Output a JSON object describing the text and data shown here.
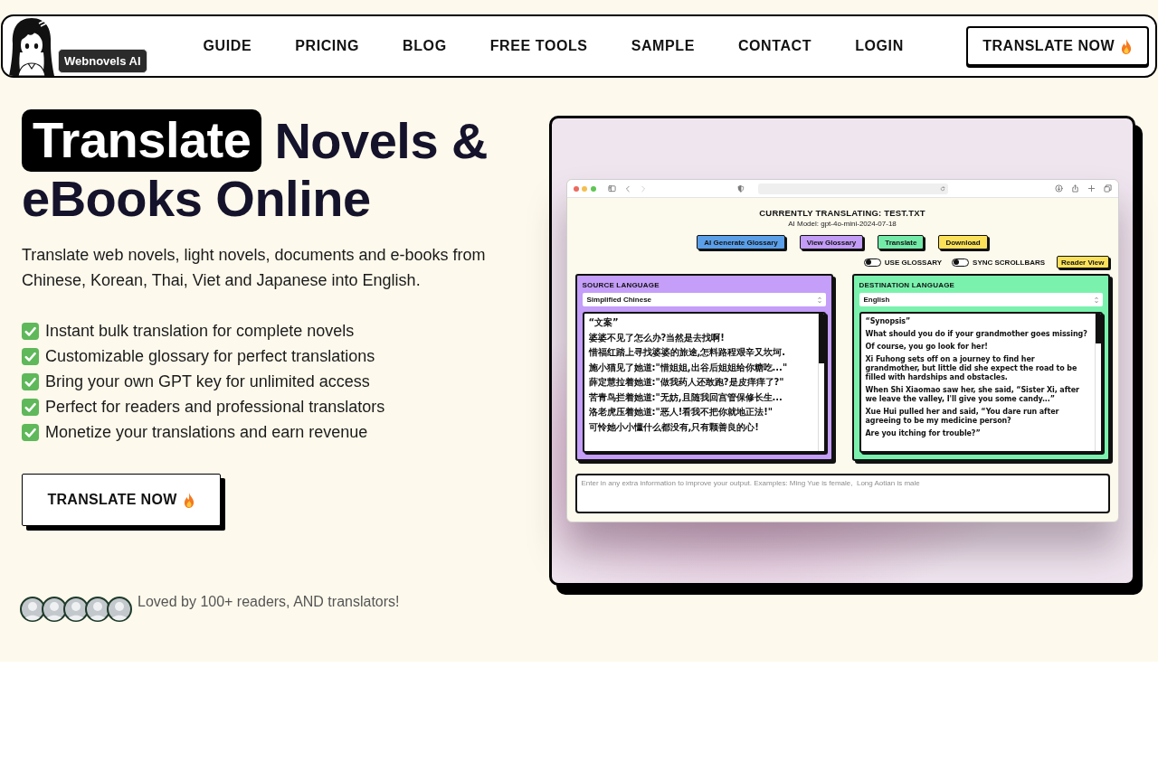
{
  "header": {
    "logo_badge": "Webnovels AI",
    "nav": [
      "GUIDE",
      "PRICING",
      "BLOG",
      "FREE TOOLS",
      "SAMPLE",
      "CONTACT",
      "LOGIN"
    ],
    "cta": "TRANSLATE NOW"
  },
  "hero": {
    "title": [
      {
        "text": "Translate",
        "highlighted": true
      },
      {
        "text": "Novels &",
        "highlighted": false
      },
      {
        "text": "eBooks Online",
        "highlighted": false
      }
    ],
    "description": "Translate web novels, light novels, documents and e-books from Chinese, Korean, Thai, Viet and Japanese into English.",
    "features": [
      "Instant bulk translation for complete novels",
      "Customizable glossary for perfect translations",
      "Bring your own GPT key for unlimited access",
      "Perfect for readers and professional translators",
      "Monetize your translations and earn revenue"
    ],
    "cta": "TRANSLATE NOW",
    "social_proof": "Loved by 100+ readers, AND translators!"
  },
  "preview": {
    "title": "CURRENTLY TRANSLATING: TEST.TXT",
    "model": "AI Model: gpt-4o-mini-2024-07-18",
    "actions": [
      {
        "label": "AI Generate Glossary",
        "color": "#5b9fe8"
      },
      {
        "label": "View Glossary",
        "color": "#c29cf6"
      },
      {
        "label": "Translate",
        "color": "#74eaa8"
      },
      {
        "label": "Download",
        "color": "#fbe15a"
      }
    ],
    "toggles": [
      {
        "label": "USE GLOSSARY",
        "on": false
      },
      {
        "label": "SYNC SCROLLBARS",
        "on": false
      }
    ],
    "reader_view": "Reader View",
    "panels": [
      {
        "kind": "source",
        "heading": "SOURCE LANGUAGE",
        "language": "Simplified Chinese",
        "color": "#c49ef8",
        "paragraphs": [
          "“文案”",
          "婆婆不见了怎么办?当然是去找啊!",
          "惜福红踏上寻找婆婆的旅途,怎料路程艰辛又坎坷.",
          "施小猫见了她道:\"惜姐姐,出谷后姐姐给你糖吃...\"",
          "薛定慧拉着她道:\"做我药人还敢跑?是皮痒痒了?\"",
          "苦青鸟拦着她道:\"无妨,且随我回宫管保修长生...",
          "洛老虎压着她道:\"恶人!看我不把你就地正法!\"",
          "可怜她小小懂什么都没有,只有颗善良的心!"
        ]
      },
      {
        "kind": "destination",
        "heading": "DESTINATION LANGUAGE",
        "language": "English",
        "color": "#7af2ae",
        "paragraphs": [
          "“Synopsis”",
          "What should you do if your grandmother goes missing?",
          "Of course, you go look for her!",
          "Xi Fuhong sets off on a journey to find her grandmother, but little did she expect the road to be filled with hardships and obstacles.",
          "When Shi Xiaomao saw her, she said, “Sister Xi, after we leave the valley, I'll give you some candy...”",
          "Xue Hui pulled her and said, “You dare run after agreeing to be my medicine person?",
          "Are you itching for trouble?”"
        ]
      }
    ],
    "notes_placeholder": "Enter in any extra information to improve your output. Examples: Ming Yue is female,  Long Aotian is male"
  }
}
